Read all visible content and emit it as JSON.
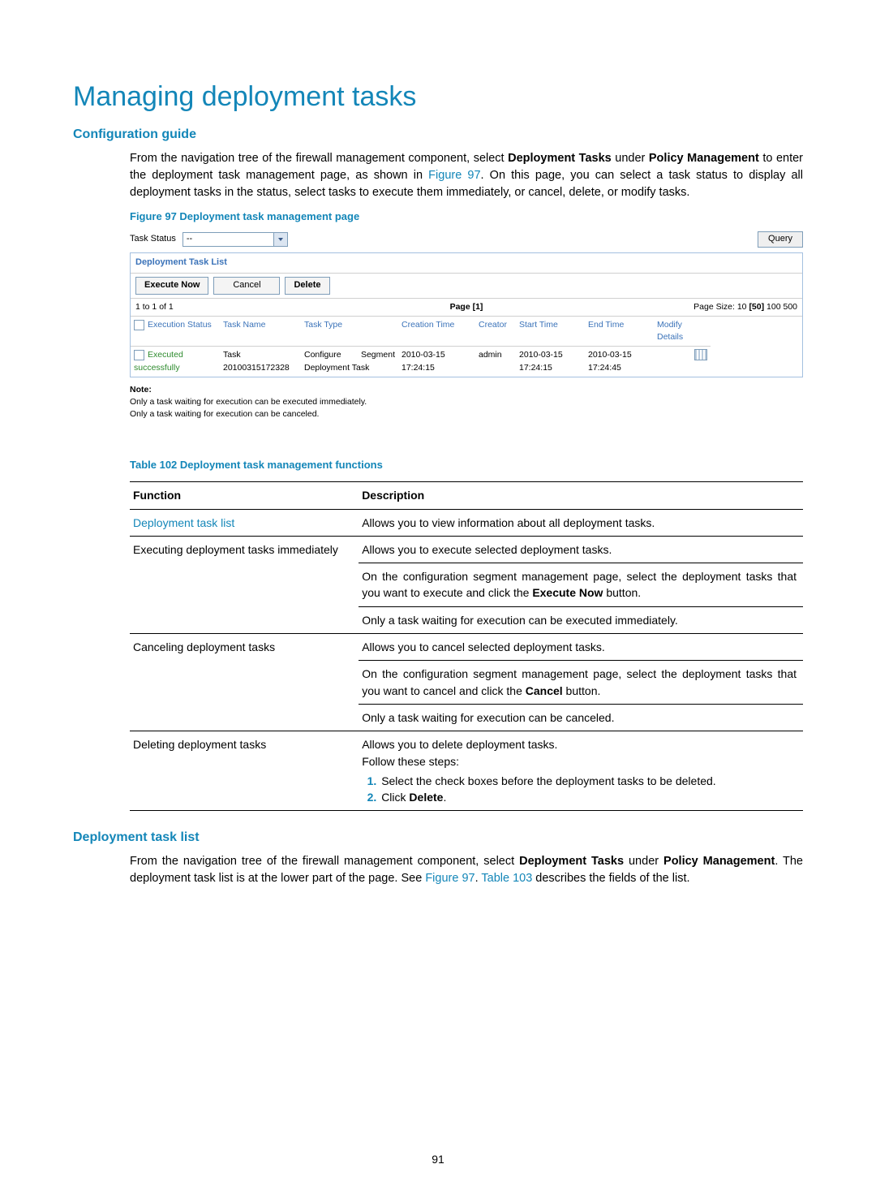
{
  "h1": "Managing deployment tasks",
  "sec1": {
    "title": "Configuration guide",
    "para_pre": "From the navigation tree of the firewall management component, select ",
    "bold1": "Deployment Tasks",
    "mid1": " under ",
    "bold2": "Policy Management",
    "mid2": " to enter the deployment task management page, as shown in ",
    "figref": "Figure 97",
    "post": ". On this page, you can select a task status to display all deployment tasks in the status, select tasks to execute them immediately, or cancel, delete, or modify tasks.",
    "fig_caption": "Figure 97 Deployment task management page"
  },
  "fig": {
    "task_status_label": "Task Status",
    "select_value": "--",
    "query_btn": "Query",
    "panel_title": "Deployment Task List",
    "btn_exec": "Execute Now",
    "btn_cancel": "Cancel",
    "btn_delete": "Delete",
    "meta_left": "1 to 1 of 1",
    "meta_center_pre": "Page ",
    "meta_center_page": "[1]",
    "meta_right_pre": "Page Size: 10 ",
    "meta_right_sel": "[50]",
    "meta_right_post": " 100 500",
    "cols": {
      "c1": "Execution Status",
      "c2": "Task Name",
      "c3": "Task Type",
      "c4": "Creation Time",
      "c5": "Creator",
      "c6": "Start Time",
      "c7": "End Time",
      "c8": "Modify",
      "c9": "Details"
    },
    "row": {
      "status": "Executed successfully",
      "name": "Task 20100315172328",
      "type": "Configure Segment Deployment Task",
      "ctime": "2010-03-15 17:24:15",
      "creator": "admin",
      "stime": "2010-03-15 17:24:15",
      "etime": "2010-03-15 17:24:45"
    },
    "note_title": "Note:",
    "note_l1": "Only a task waiting for execution can be executed immediately.",
    "note_l2": "Only a task waiting for execution can be canceled."
  },
  "tbl": {
    "caption": "Table 102 Deployment task management functions",
    "th1": "Function",
    "th2": "Description",
    "r1_f": "Deployment task list",
    "r1_d": "Allows you to view information about all deployment tasks.",
    "r2_f": "Executing deployment tasks immediately",
    "r2_d1": "Allows you to execute selected deployment tasks.",
    "r2_d2_pre": "On the configuration segment management page, select the deployment tasks that you want to execute and click the ",
    "r2_d2_bold": "Execute Now",
    "r2_d2_post": " button.",
    "r2_d3": "Only a task waiting for execution can be executed immediately.",
    "r3_f": "Canceling deployment tasks",
    "r3_d1": "Allows you to cancel selected deployment tasks.",
    "r3_d2_pre": "On the configuration segment management page, select the deployment tasks that you want to cancel and click the ",
    "r3_d2_bold": "Cancel",
    "r3_d2_post": " button.",
    "r3_d3": "Only a task waiting for execution can be canceled.",
    "r4_f": "Deleting deployment tasks",
    "r4_d1": "Allows you to delete deployment tasks.",
    "r4_d2": "Follow these steps:",
    "r4_step1": "Select the check boxes before the deployment tasks to be deleted.",
    "r4_step2_pre": "Click ",
    "r4_step2_bold": "Delete",
    "r4_step2_post": "."
  },
  "sec2": {
    "title": "Deployment task list",
    "pre": "From the navigation tree of the firewall management component, select ",
    "b1": "Deployment Tasks",
    "mid1": " under ",
    "b2": "Policy Management",
    "mid2": ". The deployment task list is at the lower part of the page. See ",
    "ref1": "Figure 97",
    "mid3": ". ",
    "ref2": "Table 103",
    "post": " describes the fields of the list."
  },
  "pagenum": "91"
}
